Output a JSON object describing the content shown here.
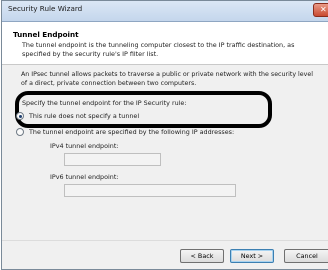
{
  "window": {
    "title": "Security Rule Wizard",
    "close_icon": "close-icon"
  },
  "header": {
    "title": "Tunnel Endpoint",
    "description": "The tunnel endpoint is the tunneling computer closest to the IP traffic destination, as specified by the security rule's IP filter list."
  },
  "body": {
    "intro": "An IPsec tunnel allows packets to traverse a public or private network with the security level of a direct, private connection between two computers.",
    "specify_label": "Specify the tunnel endpoint for the IP Security rule:",
    "options": [
      {
        "label": "This rule does not specify a tunnel",
        "checked": true
      },
      {
        "label": "The tunnel endpoint are specified by the following IP addresses:",
        "checked": false
      }
    ],
    "ipv4_label": "IPv4 tunnel endpoint:",
    "ipv4_value": "",
    "ipv6_label": "IPv6 tunnel endpoint:",
    "ipv6_value": ""
  },
  "buttons": {
    "back": "< Back",
    "next": "Next >",
    "cancel": "Cancel"
  }
}
